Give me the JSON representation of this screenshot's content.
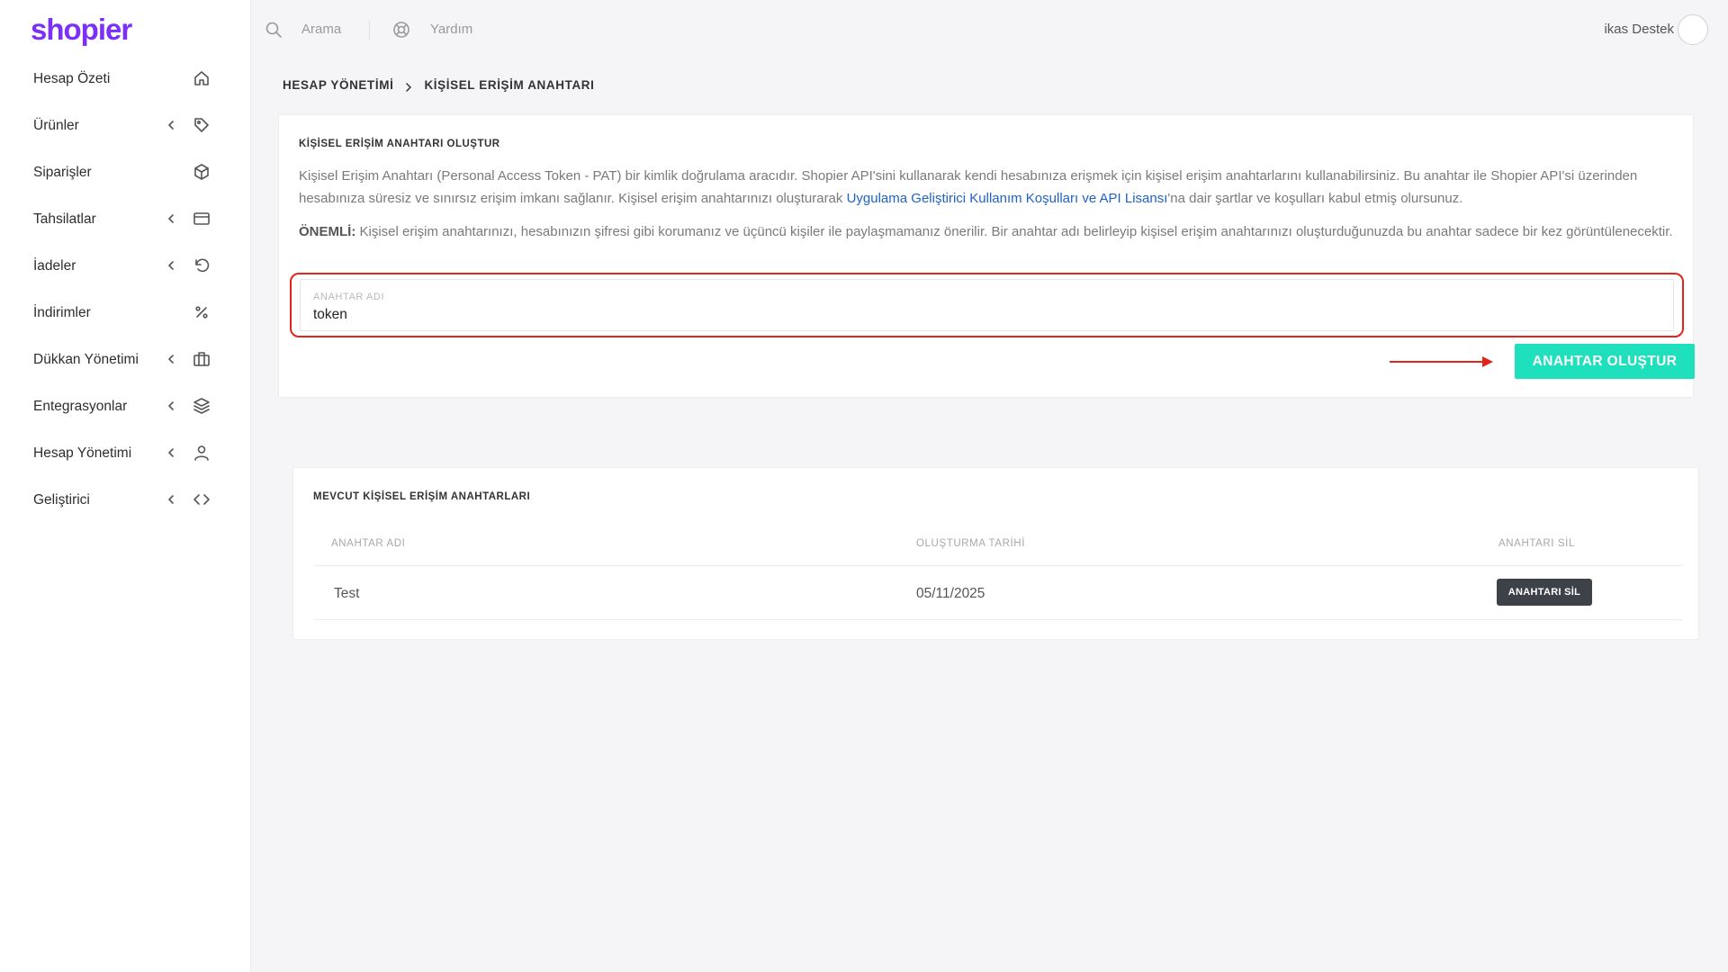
{
  "brand": {
    "name": "shopier",
    "color": "#7b2ff7"
  },
  "sidebar": {
    "items": [
      {
        "label": "Hesap Özeti",
        "icon": "home-icon",
        "chevron": false
      },
      {
        "label": "Ürünler",
        "icon": "tag-icon",
        "chevron": true
      },
      {
        "label": "Siparişler",
        "icon": "box-icon",
        "chevron": false
      },
      {
        "label": "Tahsilatlar",
        "icon": "credit-card-icon",
        "chevron": true
      },
      {
        "label": "İadeler",
        "icon": "undo-icon",
        "chevron": true
      },
      {
        "label": "İndirimler",
        "icon": "percent-icon",
        "chevron": false
      },
      {
        "label": "Dükkan Yönetimi",
        "icon": "briefcase-icon",
        "chevron": true
      },
      {
        "label": "Entegrasyonlar",
        "icon": "layers-icon",
        "chevron": true
      },
      {
        "label": "Hesap Yönetimi",
        "icon": "user-icon",
        "chevron": true
      },
      {
        "label": "Geliştirici",
        "icon": "code-icon",
        "chevron": true
      }
    ]
  },
  "topbar": {
    "search_label": "Arama",
    "help_label": "Yardım",
    "user_name": "ikas Destek"
  },
  "breadcrumb": {
    "parent": "HESAP YÖNETİMİ",
    "current": "KİŞİSEL ERİŞİM ANAHTARI"
  },
  "create_card": {
    "title": "KİŞİSEL ERİŞİM ANAHTARI OLUŞTUR",
    "description_before_link": "Kişisel Erişim Anahtarı (Personal Access Token - PAT) bir kimlik doğrulama aracıdır. Shopier API'sini kullanarak kendi hesabınıza erişmek için kişisel erişim anahtarlarını kullanabilirsiniz. Bu anahtar ile Shopier API'si üzerinden hesabınıza süresiz ve sınırsız erişim imkanı sağlanır. Kişisel erişim anahtarınızı oluşturarak ",
    "description_link": "Uygulama Geliştirici Kullanım Koşulları ve API Lisansı",
    "description_after_link": "'na dair şartlar ve koşulları kabul etmiş olursunuz.",
    "important_label": "ÖNEMLİ:",
    "important_text": " Kişisel erişim anahtarınızı, hesabınızın şifresi gibi korumanız ve üçüncü kişiler ile paylaşmamanız önerilir. Bir anahtar adı belirleyip kişisel erişim anahtarınızı oluşturduğunuzda bu anahtar sadece bir kez görüntülenecektir.",
    "field_label": "ANAHTAR ADI",
    "field_value": "token",
    "button_label": "ANAHTAR OLUŞTUR",
    "button_color": "#1fe0bd",
    "highlight_color": "#e1251b"
  },
  "list_card": {
    "title": "MEVCUT KİŞİSEL ERİŞİM ANAHTARLARI",
    "columns": [
      "ANAHTAR ADI",
      "OLUŞTURMA TARİHİ",
      "ANAHTARI SİL"
    ],
    "rows": [
      {
        "name": "Test",
        "created": "05/11/2025",
        "delete_label": "ANAHTARI SİL"
      }
    ]
  }
}
